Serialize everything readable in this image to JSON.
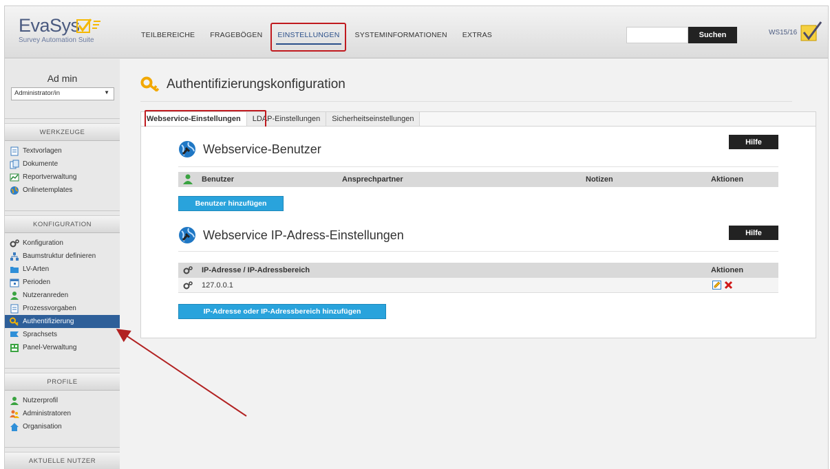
{
  "logo": {
    "name": "EvaSys",
    "subtitle": "Survey Automation Suite"
  },
  "nav": {
    "items": [
      {
        "label": "TEILBEREICHE"
      },
      {
        "label": "FRAGEBÖGEN"
      },
      {
        "label": "EINSTELLUNGEN"
      },
      {
        "label": "SYSTEMINFORMATIONEN"
      },
      {
        "label": "EXTRAS"
      }
    ],
    "active": "EINSTELLUNGEN"
  },
  "search": {
    "button_label": "Suchen",
    "value": ""
  },
  "semester": "WS15/16",
  "user": {
    "name": "Ad min",
    "role": "Administrator/in"
  },
  "sidebar": {
    "werkzeuge": {
      "title": "WERKZEUGE",
      "items": [
        {
          "label": "Textvorlagen",
          "icon": "document-icon"
        },
        {
          "label": "Dokumente",
          "icon": "documents-icon"
        },
        {
          "label": "Reportverwaltung",
          "icon": "report-icon"
        },
        {
          "label": "Onlinetemplates",
          "icon": "globe-icon"
        }
      ]
    },
    "konfiguration": {
      "title": "KONFIGURATION",
      "items": [
        {
          "label": "Konfiguration",
          "icon": "gears-icon"
        },
        {
          "label": "Baumstruktur definieren",
          "icon": "tree-icon"
        },
        {
          "label": "LV-Arten",
          "icon": "folder-icon"
        },
        {
          "label": "Perioden",
          "icon": "calendar-icon"
        },
        {
          "label": "Nutzeranreden",
          "icon": "user-icon"
        },
        {
          "label": "Prozessvorgaben",
          "icon": "document-icon"
        },
        {
          "label": "Authentifizierung",
          "icon": "key-icon"
        },
        {
          "label": "Sprachsets",
          "icon": "flag-icon"
        },
        {
          "label": "Panel-Verwaltung",
          "icon": "panel-icon"
        }
      ],
      "active": "Authentifizierung"
    },
    "profile": {
      "title": "PROFILE",
      "items": [
        {
          "label": "Nutzerprofil",
          "icon": "user-icon"
        },
        {
          "label": "Administratoren",
          "icon": "admins-icon"
        },
        {
          "label": "Organisation",
          "icon": "home-icon"
        }
      ]
    },
    "aktuelle_nutzer": {
      "title": "AKTUELLE NUTZER"
    }
  },
  "page": {
    "title": "Authentifizierungskonfiguration"
  },
  "tabs": [
    {
      "label": "Webservice-Einstellungen",
      "active": true
    },
    {
      "label": "LDAP-Einstellungen",
      "active": false
    },
    {
      "label": "Sicherheitseinstellungen",
      "active": false
    }
  ],
  "users_section": {
    "title": "Webservice-Benutzer",
    "help_label": "Hilfe",
    "columns": [
      "Benutzer",
      "Ansprechpartner",
      "Notizen",
      "Aktionen"
    ],
    "rows": [],
    "add_label": "Benutzer hinzufügen"
  },
  "ip_section": {
    "title": "Webservice IP-Adress-Einstellungen",
    "help_label": "Hilfe",
    "columns": [
      "IP-Adresse / IP-Adressbereich",
      "Aktionen"
    ],
    "rows": [
      {
        "ip": "127.0.0.1"
      }
    ],
    "add_label": "IP-Adresse oder IP-Adressbereich hinzufügen"
  },
  "colors": {
    "accent_blue": "#29a3dc",
    "active_nav": "#2e5f99",
    "highlight_red": "#c0191e",
    "arrow_red": "#b22222"
  }
}
